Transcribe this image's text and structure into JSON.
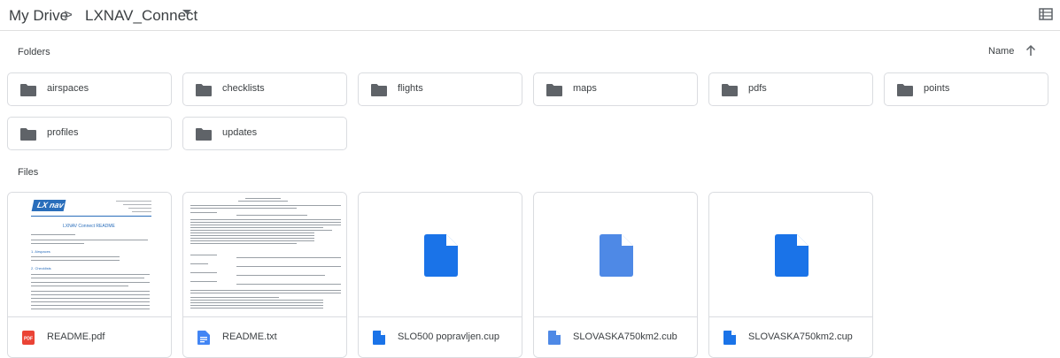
{
  "header": {
    "root": "My Drive",
    "separator": ">",
    "current": "LXNAV_Connect"
  },
  "sections": {
    "folders_label": "Folders",
    "files_label": "Files",
    "sort_label": "Name"
  },
  "folders": [
    "airspaces",
    "checklists",
    "flights",
    "maps",
    "pdfs",
    "points",
    "profiles",
    "updates"
  ],
  "files": [
    {
      "name": "README.pdf",
      "type": "pdf"
    },
    {
      "name": "README.txt",
      "type": "doc"
    },
    {
      "name": "SLO500 popravljen.cup",
      "type": "generic"
    },
    {
      "name": "SLOVASKA750km2.cub",
      "type": "generic"
    },
    {
      "name": "SLOVASKA750km2.cup",
      "type": "generic"
    }
  ],
  "pdf_preview": {
    "logo": "LX nav",
    "doc_title": "LXNAV Connect README",
    "section_1": "1. Airspaces",
    "section_2": "2. Checklists"
  },
  "colors": {
    "folder_icon": "#5f6368",
    "pdf_red": "#ea4335",
    "doc_blue": "#4285f4",
    "file_blue": "#1a73e8",
    "logo_blue": "#2a6ebb"
  },
  "icons": {
    "view_toggle": "details-icon",
    "sort": "arrow-up-icon",
    "folder": "folder-icon"
  }
}
